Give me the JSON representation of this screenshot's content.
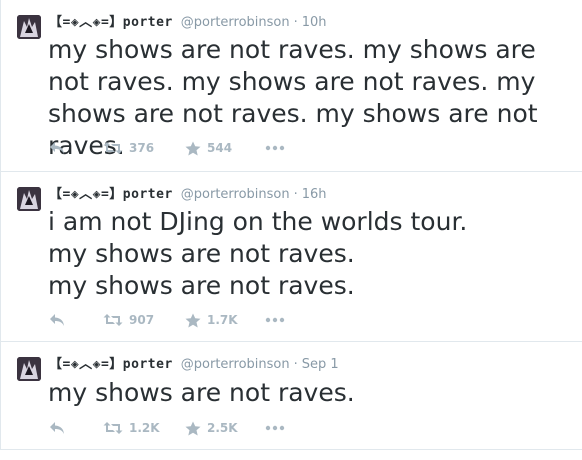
{
  "tweets": [
    {
      "name": "【=◈︿◈=】porter",
      "username": "@porterrobinson",
      "time": "10h",
      "text": "my shows are not raves. my shows are not raves. my shows are not raves. my shows are not raves. my shows are not raves.",
      "retweets": "376",
      "favorites": "544"
    },
    {
      "name": "【=◈︿◈=】porter",
      "username": "@porterrobinson",
      "time": "16h",
      "text": "i am not DJing on the worlds tour.\nmy shows are not raves.\nmy shows are not raves.",
      "retweets": "907",
      "favorites": "1.7K"
    },
    {
      "name": "【=◈︿◈=】porter",
      "username": "@porterrobinson",
      "time": "Sep 1",
      "text": "my shows are not raves.",
      "retweets": "1.2K",
      "favorites": "2.5K"
    }
  ],
  "separator": "·",
  "colors": {
    "text": "#292f33",
    "meta": "#8899a6",
    "icon": "#aab8c2",
    "border": "#e1e8ed"
  },
  "icons": [
    "avatar",
    "reply-icon",
    "retweet-icon",
    "favorite-star-icon",
    "more-icon"
  ]
}
